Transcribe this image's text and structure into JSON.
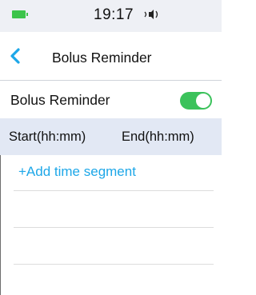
{
  "status_bar": {
    "time": "19:17",
    "battery_icon": "battery-icon",
    "volume_icon": "speaker-icon",
    "battery_color": "#3cc44a"
  },
  "nav": {
    "back_icon": "chevron-left-icon",
    "title": "Bolus Reminder",
    "accent": "#1da7e8"
  },
  "settings": {
    "bolus_reminder_label": "Bolus Reminder",
    "bolus_reminder_on": true,
    "toggle_color": "#3bc25b"
  },
  "time_table": {
    "start_header": "Start(hh:mm)",
    "end_header": "End(hh:mm)",
    "add_label": "+Add time segment",
    "header_bg": "#e2e8f4"
  }
}
